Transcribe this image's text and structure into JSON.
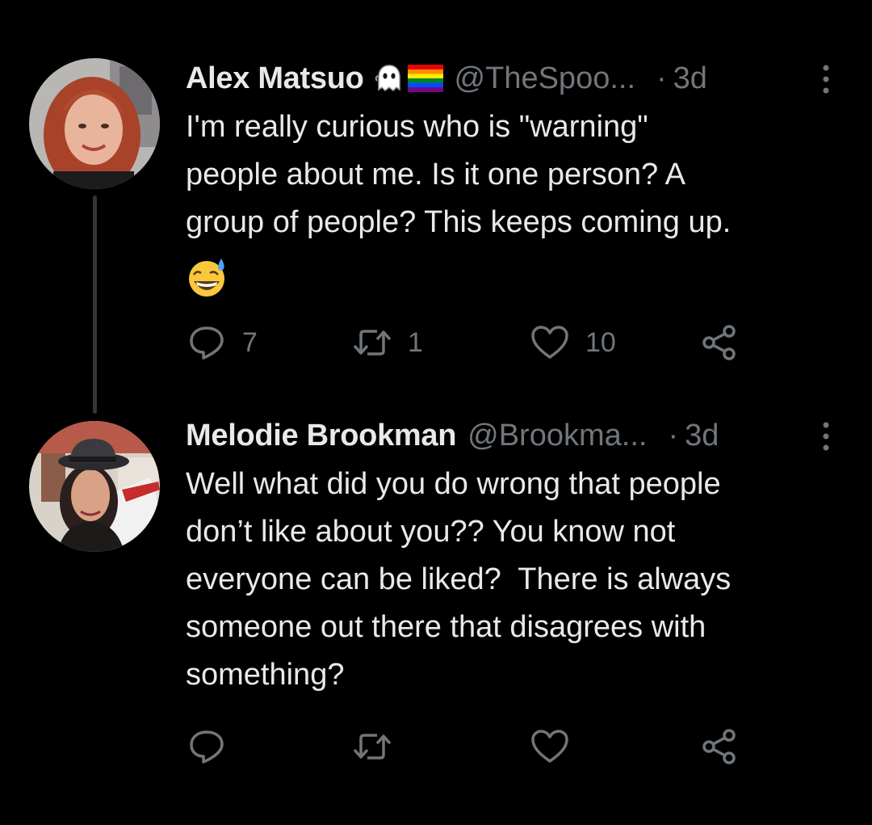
{
  "tweets": [
    {
      "display_name": "Alex Matsuo",
      "badges": [
        "ghost-emoji",
        "rainbow-flag-emoji"
      ],
      "handle": "@TheSpoo...",
      "dot": "·",
      "time": "3d",
      "text": "I'm really curious who is \"warning\"\npeople about me. Is it one person? A\ngroup of people? This keeps coming up.",
      "trailing_emoji": "grinning-face-with-sweat",
      "actions": {
        "reply_count": "7",
        "retweet_count": "1",
        "like_count": "10"
      }
    },
    {
      "display_name": "Melodie Brookman",
      "handle": "@Brookma...",
      "dot": "·",
      "time": "3d",
      "text": "Well what did you do wrong that people\ndon’t like about you?? You know not\neveryone can be liked?  There is always\nsomeone out there that disagrees with\nsomething?",
      "actions": {
        "reply_count": "",
        "retweet_count": "",
        "like_count": ""
      }
    }
  ],
  "colors": {
    "background": "#000000",
    "primary_text": "#e7e9ea",
    "secondary_text": "#71767b",
    "thread_line": "#333639"
  },
  "icons": [
    "reply-icon",
    "retweet-icon",
    "like-icon",
    "share-icon",
    "more-icon"
  ]
}
